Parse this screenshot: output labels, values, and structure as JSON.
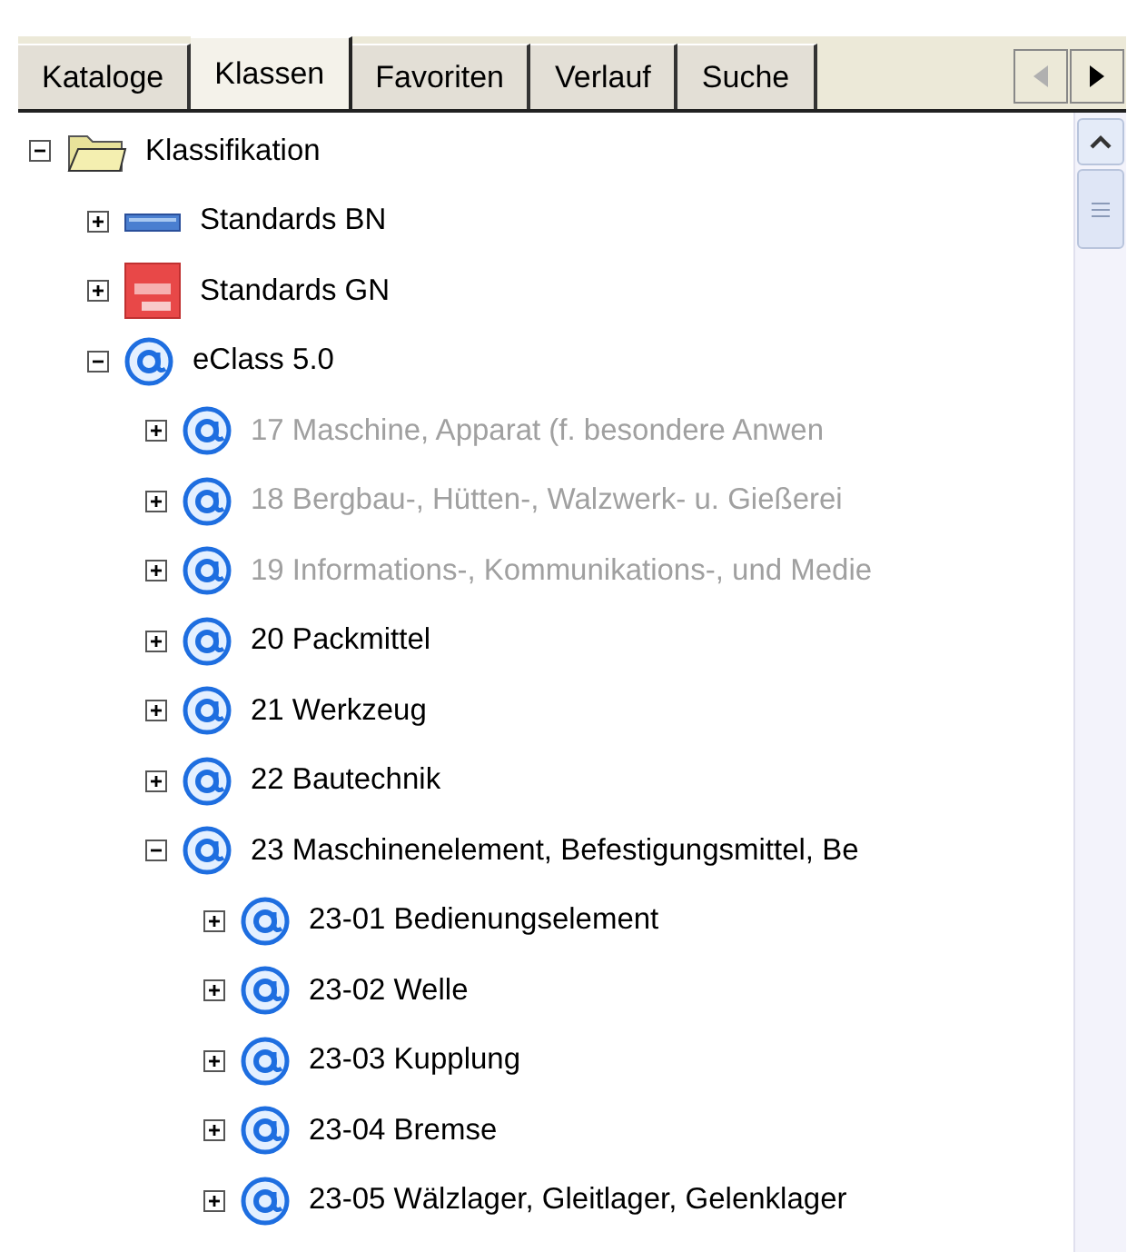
{
  "tabs": [
    {
      "label": "Kataloge",
      "selected": false
    },
    {
      "label": "Klassen",
      "selected": true
    },
    {
      "label": "Favoriten",
      "selected": false
    },
    {
      "label": "Verlauf",
      "selected": false
    },
    {
      "label": "Suche",
      "selected": false
    }
  ],
  "tab_scroll": {
    "left_disabled": true,
    "right_disabled": false
  },
  "tree": [
    {
      "label": "Klassifikation",
      "kind": "folder",
      "expanded": true,
      "disabled": false,
      "children": [
        {
          "label": "Standards BN",
          "kind": "standard-bn",
          "expanded": false,
          "disabled": false
        },
        {
          "label": "Standards GN",
          "kind": "standard-gn",
          "expanded": false,
          "disabled": false
        },
        {
          "label": "eClass 5.0",
          "kind": "eclass",
          "expanded": true,
          "disabled": false,
          "children": [
            {
              "label": "17 Maschine, Apparat (f. besondere Anwen",
              "kind": "eclass",
              "expanded": false,
              "disabled": true
            },
            {
              "label": "18 Bergbau-, Hütten-, Walzwerk- u. Gießerei",
              "kind": "eclass",
              "expanded": false,
              "disabled": true
            },
            {
              "label": "19 Informations-, Kommunikations-, und Medie",
              "kind": "eclass",
              "expanded": false,
              "disabled": true
            },
            {
              "label": "20 Packmittel",
              "kind": "eclass",
              "expanded": false,
              "disabled": false
            },
            {
              "label": "21 Werkzeug",
              "kind": "eclass",
              "expanded": false,
              "disabled": false
            },
            {
              "label": "22 Bautechnik",
              "kind": "eclass",
              "expanded": false,
              "disabled": false
            },
            {
              "label": "23 Maschinenelement, Befestigungsmittel, Be",
              "kind": "eclass",
              "expanded": true,
              "disabled": false,
              "children": [
                {
                  "label": "23-01 Bedienungselement",
                  "kind": "eclass",
                  "expanded": false,
                  "disabled": false
                },
                {
                  "label": "23-02 Welle",
                  "kind": "eclass",
                  "expanded": false,
                  "disabled": false
                },
                {
                  "label": "23-03 Kupplung",
                  "kind": "eclass",
                  "expanded": false,
                  "disabled": false
                },
                {
                  "label": "23-04 Bremse",
                  "kind": "eclass",
                  "expanded": false,
                  "disabled": false
                },
                {
                  "label": "23-05 Wälzlager, Gleitlager, Gelenklager",
                  "kind": "eclass",
                  "expanded": false,
                  "disabled": false
                }
              ]
            }
          ]
        }
      ]
    }
  ]
}
